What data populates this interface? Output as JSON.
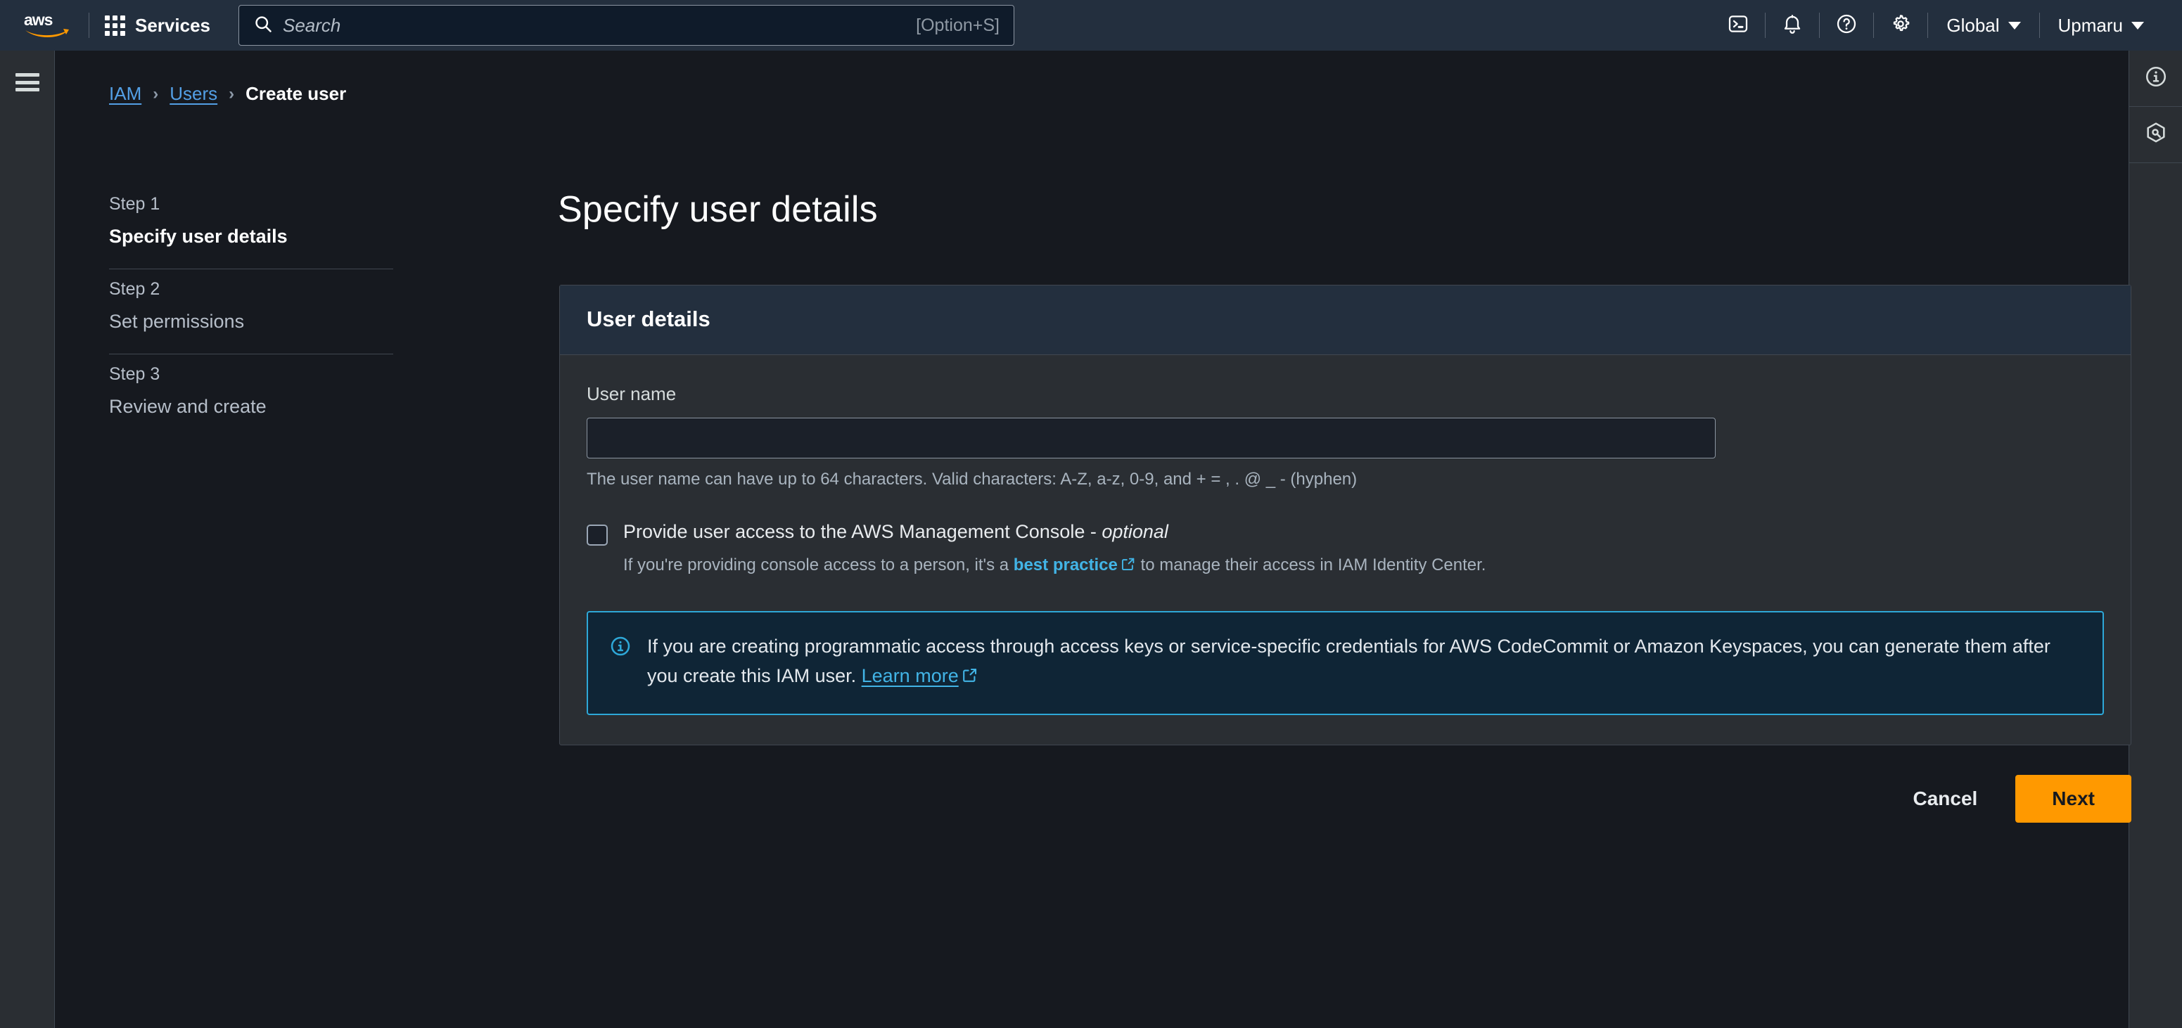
{
  "colors": {
    "nav_bg": "#232f3e",
    "page_bg": "#16191f",
    "card_bg": "#2a2e33",
    "accent_orange": "#ff9900",
    "link_blue": "#42b4e6",
    "breadcrumb_link": "#539fe5",
    "alert_border": "#2ea8d8",
    "alert_bg": "#0f2536"
  },
  "topnav": {
    "logo": "aws-logo",
    "services_label": "Services",
    "services_icon": "grid-apps-icon",
    "search": {
      "icon": "search-icon",
      "placeholder": "Search",
      "value": "",
      "shortcut": "[Option+S]"
    },
    "icons": [
      {
        "name": "cloudshell-icon",
        "label": "CloudShell"
      },
      {
        "name": "bell-notifications-icon",
        "label": "Notifications"
      },
      {
        "name": "question-help-icon",
        "label": "Help"
      },
      {
        "name": "gear-settings-icon",
        "label": "Settings"
      }
    ],
    "region_menu": "Global",
    "account_menu": "Upmaru"
  },
  "left_rail": {
    "menu_icon": "hamburger-menu-icon"
  },
  "right_rail": {
    "items": [
      {
        "name": "info-panel-icon"
      },
      {
        "name": "aws-q-assistant-icon"
      }
    ]
  },
  "breadcrumb": {
    "items": [
      {
        "label": "IAM",
        "link": true
      },
      {
        "label": "Users",
        "link": true
      },
      {
        "label": "Create user",
        "link": false
      }
    ],
    "separator": "›"
  },
  "steps": [
    {
      "number": "Step 1",
      "name": "Specify user details",
      "active": true
    },
    {
      "number": "Step 2",
      "name": "Set permissions",
      "active": false
    },
    {
      "number": "Step 3",
      "name": "Review and create",
      "active": false
    }
  ],
  "page": {
    "title": "Specify user details"
  },
  "card": {
    "title": "User details",
    "username": {
      "label": "User name",
      "value": "",
      "placeholder": "",
      "hint": "The user name can have up to 64 characters. Valid characters: A-Z, a-z, 0-9, and + = , . @ _ - (hyphen)"
    },
    "console_access": {
      "checked": false,
      "label_main": "Provide user access to the AWS Management Console",
      "label_dash": " - ",
      "label_optional": "optional",
      "desc_before": "If you're providing console access to a person, it's a ",
      "desc_link": "best practice",
      "desc_after": " to manage their access in IAM Identity Center.",
      "external_icon": "external-link-icon"
    },
    "alert": {
      "icon": "info-circle-icon",
      "text_before": "If you are creating programmatic access through access keys or service-specific credentials for AWS CodeCommit or Amazon Keyspaces, you can generate them after you create this IAM user. ",
      "link": "Learn more",
      "external_icon": "external-link-icon"
    }
  },
  "footer": {
    "cancel_label": "Cancel",
    "next_label": "Next"
  }
}
